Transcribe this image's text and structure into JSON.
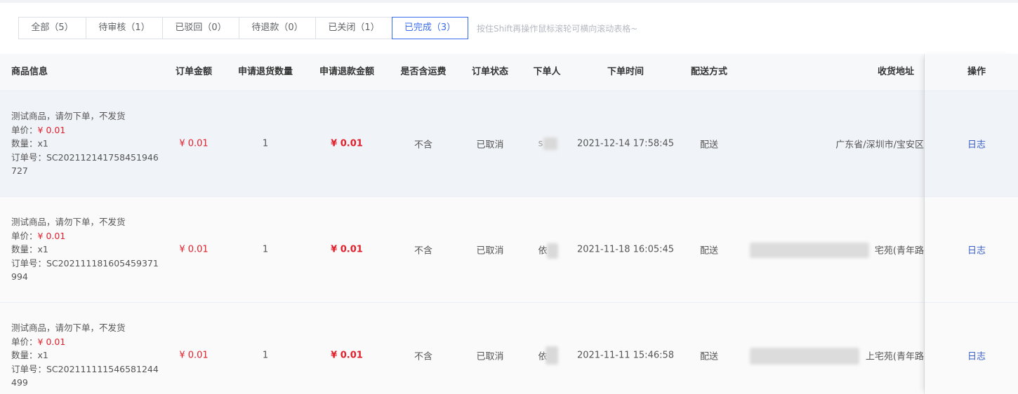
{
  "tabs": [
    {
      "label": "全部（5）",
      "active": false
    },
    {
      "label": "待审核（1）",
      "active": false
    },
    {
      "label": "已驳回（0）",
      "active": false
    },
    {
      "label": "待退款（0）",
      "active": false
    },
    {
      "label": "已关闭（1）",
      "active": false
    },
    {
      "label": "已完成（3）",
      "active": true
    }
  ],
  "hint": "按住Shift再操作鼠标滚轮可横向滚动表格~",
  "columns": {
    "goods": "商品信息",
    "amount": "订单金额",
    "return_qty": "申请退货数量",
    "refund_amount": "申请退款金额",
    "shipping": "是否含运费",
    "status": "订单状态",
    "buyer": "下单人",
    "time": "下单时间",
    "delivery": "配送方式",
    "address": "收货地址",
    "action": "操作"
  },
  "rows": [
    {
      "name": "测试商品，请勿下单，不发货",
      "price_label": "单价：",
      "price": "¥ 0.01",
      "qty": "数量：x1",
      "order_no_1": "订单号：SC202112141758451946",
      "order_no_2": "727",
      "amount": "¥ 0.01",
      "return_qty": "1",
      "refund_amount": "¥ 0.01",
      "shipping": "不含",
      "status": "已取消",
      "buyer": "s",
      "time": "2021-12-14 17:58:45",
      "delivery": "配送",
      "address": "广东省/深圳市/宝安区",
      "action": "日志"
    },
    {
      "name": "测试商品，请勿下单，不发货",
      "price_label": "单价：",
      "price": "¥ 0.01",
      "qty": "数量：x1",
      "order_no_1": "订单号：SC202111181605459371",
      "order_no_2": "994",
      "amount": "¥ 0.01",
      "return_qty": "1",
      "refund_amount": "¥ 0.01",
      "shipping": "不含",
      "status": "已取消",
      "buyer": "依",
      "time": "2021-11-18 16:05:45",
      "delivery": "配送",
      "address": "宅苑(青年路",
      "action": "日志"
    },
    {
      "name": "测试商品，请勿下单，不发货",
      "price_label": "单价：",
      "price": "¥ 0.01",
      "qty": "数量：x1",
      "order_no_1": "订单号：SC202111111546581244",
      "order_no_2": "499",
      "amount": "¥ 0.01",
      "return_qty": "1",
      "refund_amount": "¥ 0.01",
      "shipping": "不含",
      "status": "已取消",
      "buyer": "依",
      "time": "2021-11-11 15:46:58",
      "delivery": "配送",
      "address": "上宅苑(青年路",
      "action": "日志"
    }
  ],
  "colors": {
    "accent": "#3a6cf0",
    "price_red": "#e0202c",
    "link": "#3a5fc8",
    "hover_row": "#f0f3f7"
  }
}
